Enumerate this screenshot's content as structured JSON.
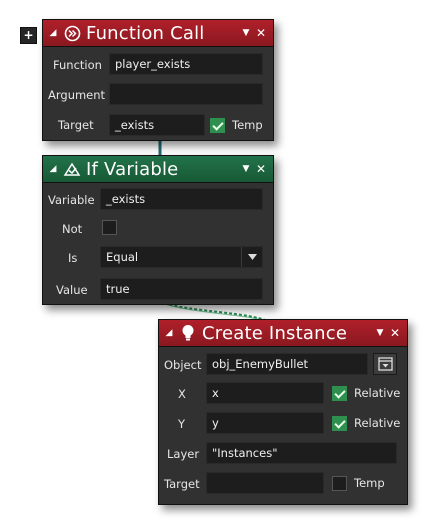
{
  "nodes": {
    "function_call": {
      "title": "Function Call",
      "function_label": "Function",
      "function_value": "player_exists",
      "argument_label": "Argument",
      "argument_value": "",
      "target_label": "Target",
      "target_value": "_exists",
      "temp_label": "Temp",
      "temp_checked": true
    },
    "if_variable": {
      "title": "If Variable",
      "variable_label": "Variable",
      "variable_value": "_exists",
      "not_label": "Not",
      "not_checked": false,
      "is_label": "Is",
      "is_value": "Equal",
      "value_label": "Value",
      "value_value": "true"
    },
    "create_instance": {
      "title": "Create Instance",
      "object_label": "Object",
      "object_value": "obj_EnemyBullet",
      "x_label": "X",
      "x_value": "x",
      "x_relative_label": "Relative",
      "x_relative_checked": true,
      "y_label": "Y",
      "y_value": "y",
      "y_relative_label": "Relative",
      "y_relative_checked": true,
      "layer_label": "Layer",
      "layer_value": "\"Instances\"",
      "target_label": "Target",
      "target_value": "",
      "temp_label": "Temp",
      "temp_checked": false
    }
  },
  "icons": {
    "expand": "+",
    "collapse": "collapse-arrow-icon",
    "menu": "menu-arrow-icon",
    "close": "close-icon",
    "function_call": "function-call-icon",
    "if_variable": "variable-check-icon",
    "create_instance": "lightbulb-icon",
    "object_picker": "object-picker-icon"
  },
  "colors": {
    "header_red": "#9b1c24",
    "header_green": "#1d6a41",
    "node_bg": "#313131",
    "field_bg": "#1d1d1d",
    "check_green": "#2f8f4f",
    "connector_green": "#2e8b57"
  }
}
